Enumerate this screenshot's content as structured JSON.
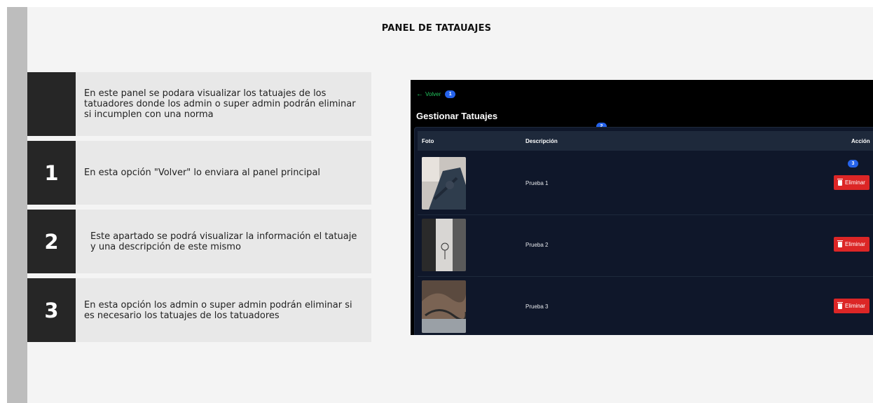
{
  "slide": {
    "title": "PANEL DE TATAUAJES",
    "items": [
      {
        "number": "",
        "text": "En este panel se podara visualizar los tatuajes de los tatuadores donde los admin o super admin podrán eliminar si incumplen con una norma"
      },
      {
        "number": "1",
        "text": "En esta opción \"Volver\" lo enviara al panel principal"
      },
      {
        "number": "2",
        "text": "Este apartado se podrá visualizar la información el tatuaje y una descripción de este mismo"
      },
      {
        "number": "3",
        "text": "En esta opción los admin o super admin podrán eliminar si es necesario los tatuajes de los tatuadores"
      }
    ]
  },
  "app": {
    "back_label": "Volver",
    "badge_1": "1",
    "badge_2": "2",
    "badge_3": "3",
    "title": "Gestionar Tatuajes",
    "columns": {
      "photo": "Foto",
      "description": "Descripción",
      "action": "Acción"
    },
    "rows": [
      {
        "description": "Prueba 1",
        "action": "Eliminar"
      },
      {
        "description": "Prueba 2",
        "action": "Eliminar"
      },
      {
        "description": "Prueba 3",
        "action": "Eliminar"
      }
    ],
    "colors": {
      "accent_green": "#22c55e",
      "badge_blue": "#2563eb",
      "delete_red": "#dc2626",
      "panel_bg": "#0f172a"
    }
  }
}
